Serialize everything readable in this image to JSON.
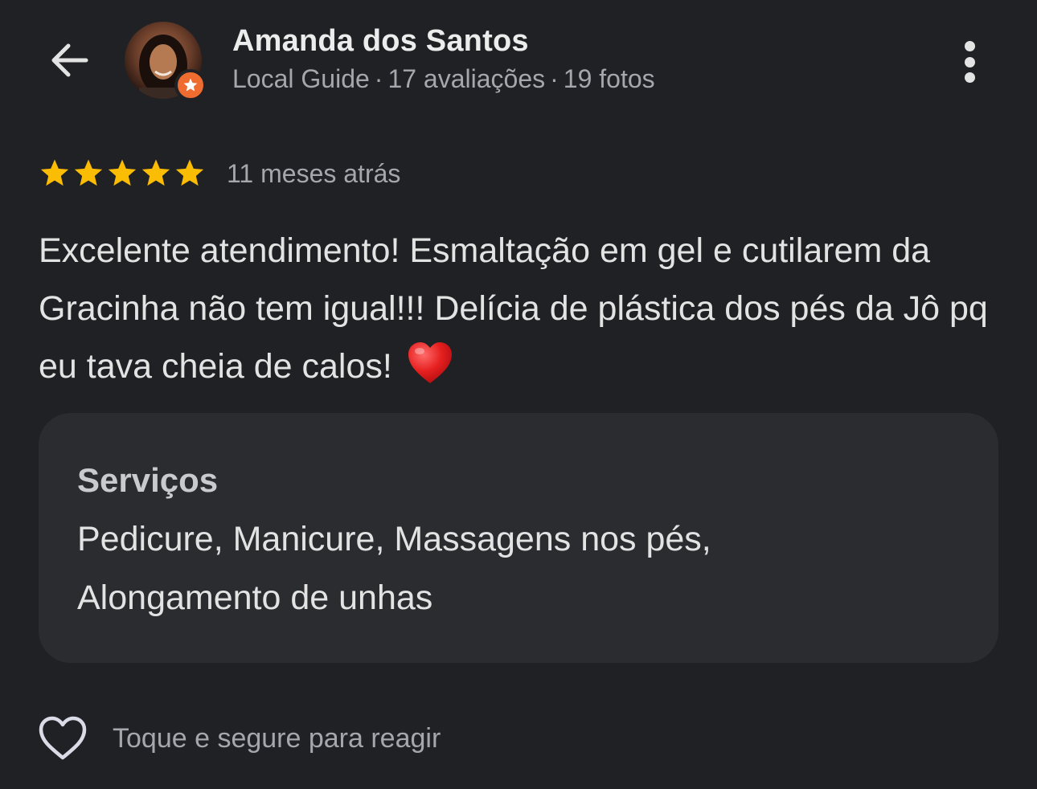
{
  "header": {
    "back_icon": "arrow-back-icon",
    "reviewer_name": "Amanda dos Santos",
    "reviewer_level": "Local Guide",
    "reviews_count": "17 avaliações",
    "photos_count": "19 fotos",
    "separator": "·",
    "badge_icon": "local-guide-star-icon",
    "more_icon": "more-vertical-icon"
  },
  "review": {
    "stars": 5,
    "stars_max": 5,
    "star_color": "#fbbc04",
    "time_ago": "11 meses atrás",
    "text": "Excelente atendimento! Esmaltação em gel e cutilarem da Gracinha não tem igual!!! Delícia de plástica dos pés da Jô pq eu tava cheia de calos!",
    "emoji": "red-heart-emoji"
  },
  "services": {
    "title": "Serviços",
    "list": "Pedicure, Manicure, Massagens nos pés, Alongamento de unhas"
  },
  "footer": {
    "react_icon": "heart-outline-icon",
    "react_label": "Toque e segure para reagir"
  },
  "colors": {
    "background": "#202124",
    "card": "#2b2c30",
    "badge": "#ee6c2f",
    "text_primary": "#e3e3e3",
    "text_secondary": "#a4a7ab"
  }
}
